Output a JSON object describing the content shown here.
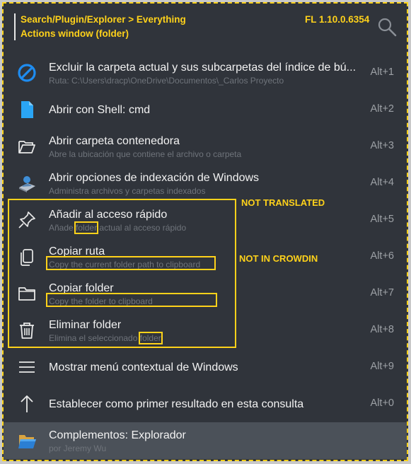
{
  "header": {
    "line1": "Search/Plugin/Explorer > Everything",
    "line2": "Actions window (folder)",
    "version": "FL 1.10.0.6354"
  },
  "rows": [
    {
      "title": "Excluir la carpeta actual y sus subcarpetas del índice de bú...",
      "sub": "Ruta: C:\\Users\\dracp\\OneDrive\\Documentos\\_Carlos Proyecto",
      "key": "Alt+1",
      "icon": "block-icon"
    },
    {
      "title": "Abrir con Shell: cmd",
      "sub": "",
      "key": "Alt+2",
      "icon": "file-icon"
    },
    {
      "title": "Abrir carpeta contenedora",
      "sub": "Abre la ubicación que contiene el archivo o carpeta",
      "key": "Alt+3",
      "icon": "folder-open-icon"
    },
    {
      "title": "Abrir opciones de indexación de Windows",
      "sub": "Administra archivos y carpetas indexados",
      "key": "Alt+4",
      "icon": "indexing-icon"
    },
    {
      "title": "Añadir al acceso rápido",
      "sub_pre": "Añade ",
      "sub_hl": "folder",
      "sub_post": " actual al acceso rápido",
      "key": "Alt+5",
      "icon": "pin-icon"
    },
    {
      "title": "Copiar ruta",
      "sub": "Copy the current folder path to clipboard",
      "key": "Alt+6",
      "icon": "copy-icon"
    },
    {
      "title": "Copiar folder",
      "sub": "Copy the folder to clipboard",
      "key": "Alt+7",
      "icon": "folder-icon"
    },
    {
      "title": "Eliminar folder",
      "sub_pre": "Elimina el seleccionado ",
      "sub_hl": "folder",
      "sub_post": "",
      "key": "Alt+8",
      "icon": "trash-icon"
    },
    {
      "title": "Mostrar menú contextual de Windows",
      "sub": "",
      "key": "Alt+9",
      "icon": "menu-icon"
    },
    {
      "title": "Establecer como primer resultado en esta consulta",
      "sub": "",
      "key": "Alt+0",
      "icon": "arrow-up-icon"
    },
    {
      "title": "Complementos: Explorador",
      "sub": "por Jeremy Wu",
      "key": "",
      "icon": "explorer-plugin-icon"
    }
  ],
  "annotations": {
    "not_translated": "NOT TRANSLATED",
    "not_in_crowdin": "NOT IN CROWDIN"
  },
  "colors": {
    "accent": "#ffd21a",
    "background": "#30343b",
    "selected": "#4b5159"
  }
}
